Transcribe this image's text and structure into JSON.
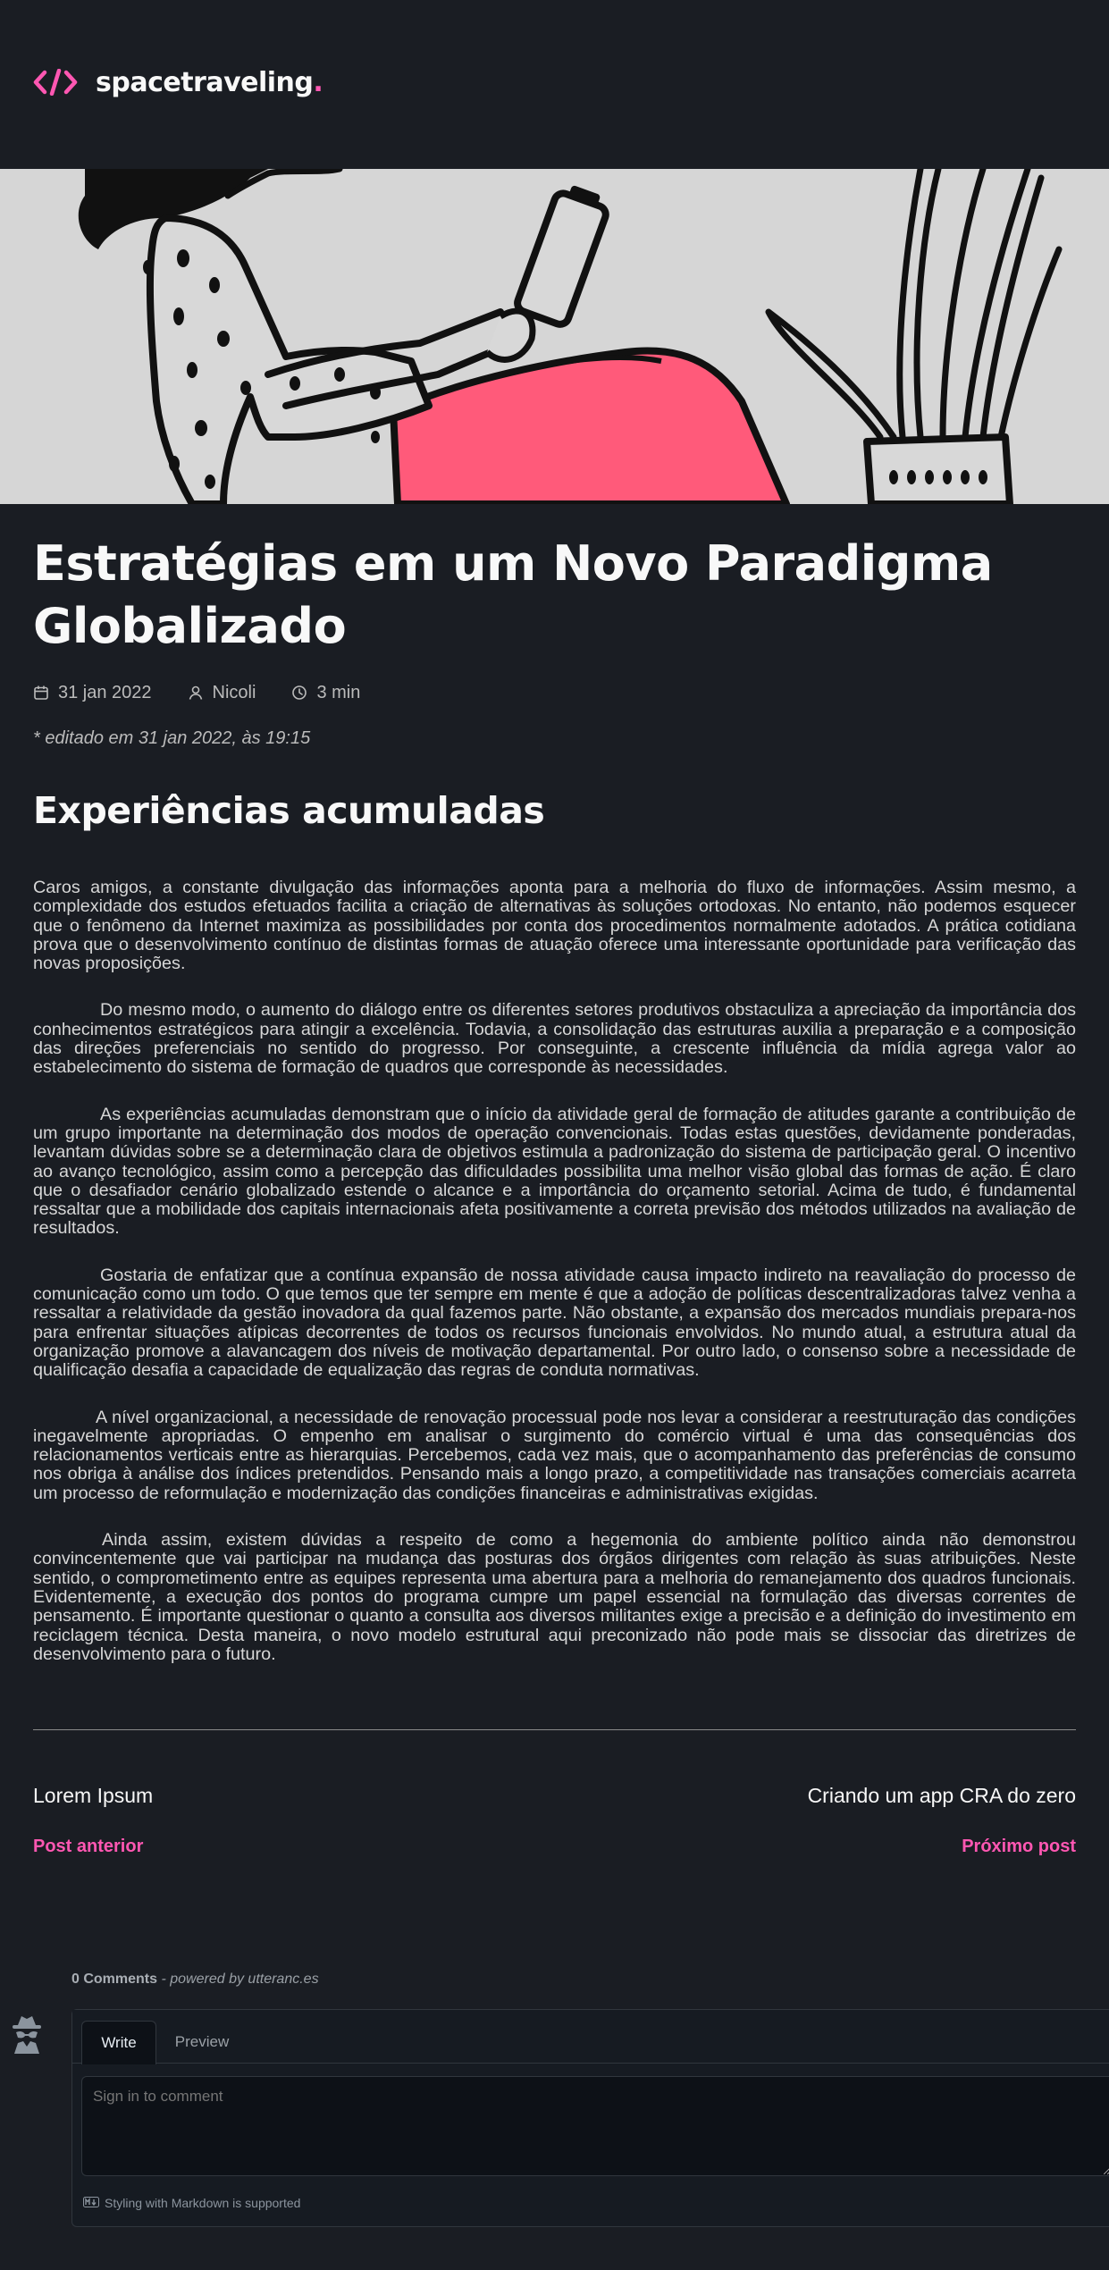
{
  "header": {
    "logo_icon": "code-brackets-icon",
    "brand_name": "spacetraveling",
    "brand_dot": ".",
    "accent_color": "#ff57b2"
  },
  "banner": {
    "image": "illustration-woman-reading-phone-with-plant"
  },
  "post": {
    "title": "Estratégias em um Novo Paradigma Globalizado",
    "date": "31 jan 2022",
    "author": "Nicoli",
    "reading_time": "3 min",
    "edited": "* editado em 31 jan 2022, às 19:15",
    "section_heading": "Experiências acumuladas",
    "paragraphs": [
      "Caros amigos, a constante divulgação das informações aponta para a melhoria do fluxo de informações. Assim mesmo, a complexidade dos estudos efetuados facilita a criação de alternativas às soluções ortodoxas. No entanto, não podemos esquecer que o fenômeno da Internet maximiza as possibilidades por conta dos procedimentos normalmente adotados. A prática cotidiana prova que o desenvolvimento contínuo de distintas formas de atuação oferece uma interessante oportunidade para verificação das novas proposições.",
      "Do mesmo modo, o aumento do diálogo entre os diferentes setores produtivos obstaculiza a apreciação da importância dos conhecimentos estratégicos para atingir a excelência. Todavia, a consolidação das estruturas auxilia a preparação e a composição das direções preferenciais no sentido do progresso. Por conseguinte, a crescente influência da mídia agrega valor ao estabelecimento do sistema de formação de quadros que corresponde às necessidades.",
      "As experiências acumuladas demonstram que o início da atividade geral de formação de atitudes garante a contribuição de um grupo importante na determinação dos modos de operação convencionais. Todas estas questões, devidamente ponderadas, levantam dúvidas sobre se a determinação clara de objetivos estimula a padronização do sistema de participação geral. O incentivo ao avanço tecnológico, assim como a percepção das dificuldades possibilita uma melhor visão global das formas de ação. É claro que o desafiador cenário globalizado estende o alcance e a importância do orçamento setorial. Acima de tudo, é fundamental ressaltar que a mobilidade dos capitais internacionais afeta positivamente a correta previsão dos métodos utilizados na avaliação de resultados.",
      "Gostaria de enfatizar que a contínua expansão de nossa atividade causa impacto indireto na reavaliação do processo de comunicação como um todo. O que temos que ter sempre em mente é que a adoção de políticas descentralizadoras talvez venha a ressaltar a relatividade da gestão inovadora da qual fazemos parte. Não obstante, a expansão dos mercados mundiais prepara-nos para enfrentar situações atípicas decorrentes de todos os recursos funcionais envolvidos. No mundo atual, a estrutura atual da organização promove a alavancagem dos níveis de motivação departamental. Por outro lado, o consenso sobre a necessidade de qualificação desafia a capacidade de equalização das regras de conduta normativas.",
      "A nível organizacional, a necessidade de renovação processual pode nos levar a considerar a reestruturação das condições inegavelmente apropriadas. O empenho em analisar o surgimento do comércio virtual é uma das consequências dos relacionamentos verticais entre as hierarquias. Percebemos, cada vez mais, que o acompanhamento das preferências de consumo nos obriga à análise dos índices pretendidos. Pensando mais a longo prazo, a competitividade nas transações comerciais acarreta um processo de reformulação e modernização das condições financeiras e administrativas exigidas.",
      "Ainda assim, existem dúvidas a respeito de como a hegemonia do ambiente político ainda não demonstrou convincentemente que vai participar na mudança das posturas dos órgãos dirigentes com relação às suas atribuições. Neste sentido, o comprometimento entre as equipes representa uma abertura para a melhoria do remanejamento dos quadros funcionais. Evidentemente, a execução dos pontos do programa cumpre um papel essencial na formulação das diversas correntes de pensamento. É importante questionar o quanto a consulta aos diversos militantes exige a precisão e a definição do investimento em reciclagem técnica. Desta maneira, o novo modelo estrutural aqui preconizado não pode mais se dissociar das diretrizes de desenvolvimento para o futuro."
    ]
  },
  "navigation": {
    "previous_title": "Lorem Ipsum",
    "previous_label": "Post anterior",
    "next_title": "Criando um app CRA do zero",
    "next_label": "Próximo post"
  },
  "comments": {
    "count": "0 Comments",
    "powered_by": " - powered by utteranc.es",
    "tab_write": "Write",
    "tab_preview": "Preview",
    "placeholder": "Sign in to comment",
    "markdown_note": "Styling with Markdown is supported"
  }
}
